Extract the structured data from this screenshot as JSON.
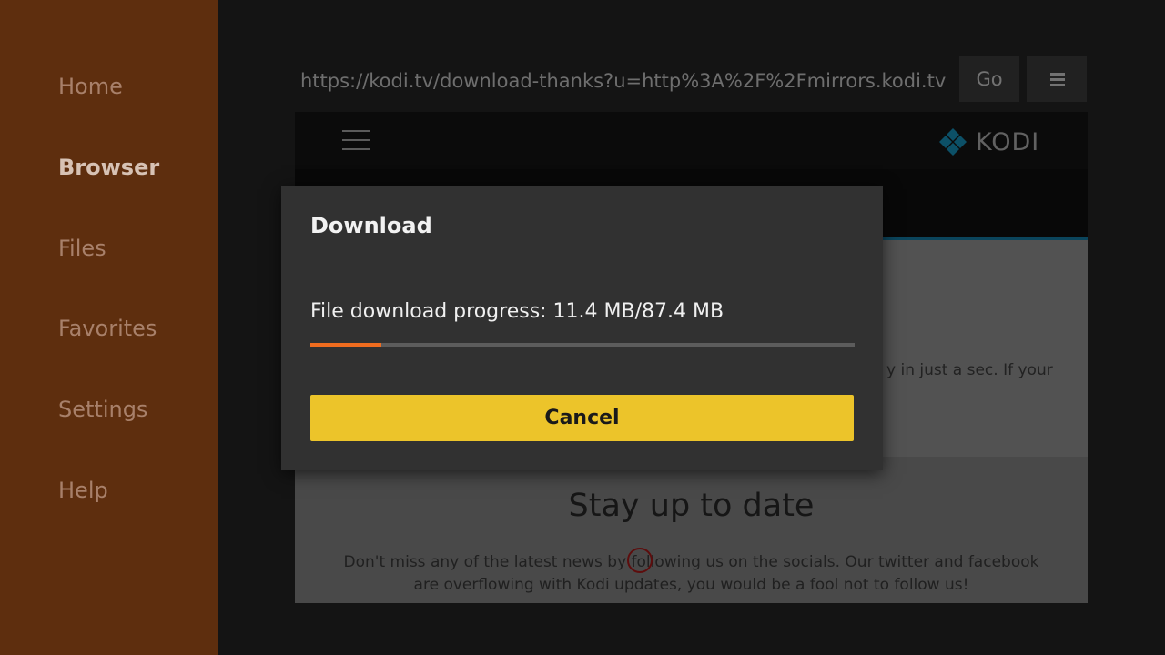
{
  "sidebar": {
    "items": [
      {
        "label": "Home",
        "active": false
      },
      {
        "label": "Browser",
        "active": true
      },
      {
        "label": "Files",
        "active": false
      },
      {
        "label": "Favorites",
        "active": false
      },
      {
        "label": "Settings",
        "active": false
      },
      {
        "label": "Help",
        "active": false
      }
    ]
  },
  "browser": {
    "url": "https://kodi.tv/download-thanks?u=http%3A%2F%2Fmirrors.kodi.tv",
    "go_label": "Go",
    "menu_icon": "hamburger-icon"
  },
  "website": {
    "logo_text": "KODI",
    "partial_text": "y in just a sec. If your",
    "heading": "Stay up to date",
    "paragraph_line1": "Don't miss any of the latest news by following us on the socials. Our twitter and facebook",
    "paragraph_line2": "are overflowing with Kodi updates, you would be a fool not to follow us!"
  },
  "dialog": {
    "title": "Download",
    "progress_text": "File download progress: 11.4 MB/87.4 MB",
    "downloaded_mb": 11.4,
    "total_mb": 87.4,
    "cancel_label": "Cancel"
  },
  "colors": {
    "sidebar_bg": "#5e2e0e",
    "progress_fill": "#ef6c1f",
    "cancel_button": "#ecc42a",
    "kodi_blue": "#17b2e7"
  }
}
